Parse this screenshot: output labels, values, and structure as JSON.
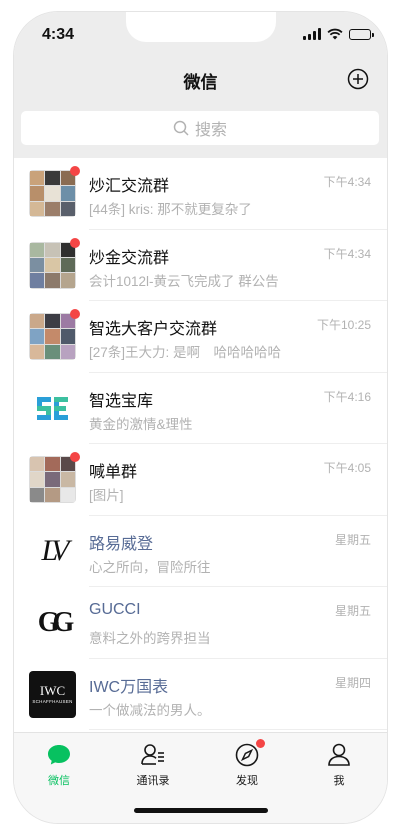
{
  "status_bar": {
    "time": "4:34"
  },
  "nav": {
    "title": "微信"
  },
  "search": {
    "placeholder": "搜索"
  },
  "chats": [
    {
      "name": "炒汇交流群",
      "time": "下午4:34",
      "preview": "[44条] kris: 那不就更复杂了",
      "unread_dot": true,
      "official": false
    },
    {
      "name": "炒金交流群",
      "time": "下午4:34",
      "preview": "会计1012l-黄云飞完成了 群公告",
      "unread_dot": true,
      "official": false
    },
    {
      "name": "智选大客户交流群",
      "time": "下午10:25",
      "preview": "[27条]王大力: 是啊　哈哈哈哈哈",
      "unread_dot": true,
      "official": false
    },
    {
      "name": "智选宝库",
      "time": "下午4:16",
      "preview": "黄金的激情&理性",
      "unread_dot": false,
      "official": false
    },
    {
      "name": "喊单群",
      "time": "下午4:05",
      "preview": "[图片]",
      "unread_dot": true,
      "official": false
    },
    {
      "name": "路易威登",
      "time": "星期五",
      "preview": "心之所向，冒险所往",
      "unread_dot": false,
      "official": true
    },
    {
      "name": "GUCCI",
      "time": "星期五",
      "preview": "意料之外的跨界担当",
      "unread_dot": false,
      "official": true
    },
    {
      "name": "IWC万国表",
      "time": "星期四",
      "preview": "一个做减法的男人。",
      "unread_dot": false,
      "official": true
    }
  ],
  "brand_logos": {
    "lv": "LV",
    "gucci": "GG",
    "iwc_main": "IWC",
    "iwc_sub": "SCHAFFHAUSEN"
  },
  "tabs": [
    {
      "label": "微信",
      "icon": "chat-bubble-icon",
      "active": true
    },
    {
      "label": "通讯录",
      "icon": "contacts-icon",
      "active": false
    },
    {
      "label": "发现",
      "icon": "compass-icon",
      "active": false,
      "dot": true
    },
    {
      "label": "我",
      "icon": "person-icon",
      "active": false
    }
  ],
  "colors": {
    "accent": "#07c160",
    "badge": "#f44545",
    "official_name": "#576b95",
    "header_bg": "#ededed"
  }
}
